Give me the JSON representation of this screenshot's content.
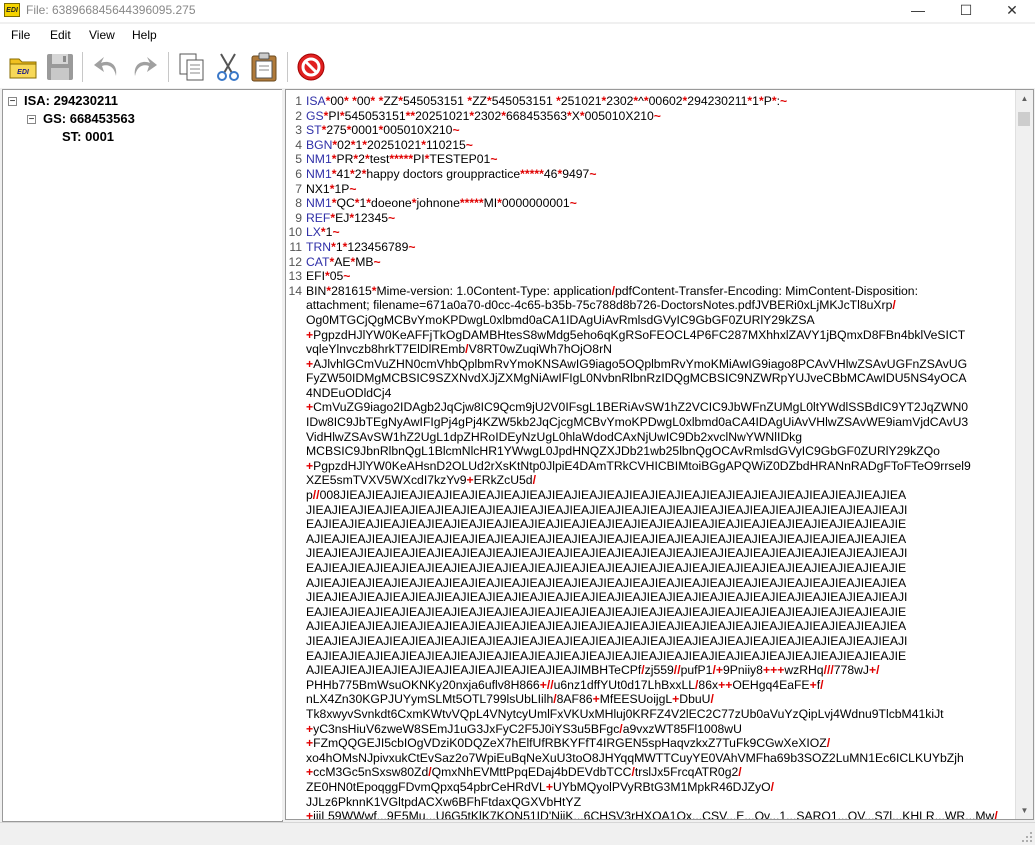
{
  "window": {
    "title": "File: 638966845644396095.275",
    "app_icon_text": "EDI",
    "minimize": "—",
    "maximize": "☐",
    "close": "✕"
  },
  "menu": [
    "File",
    "Edit",
    "View",
    "Help"
  ],
  "toolbar": [
    "open-folder-icon",
    "save-icon",
    "undo-icon",
    "redo-icon",
    "copy-icon",
    "cut-icon",
    "paste-icon",
    "stop-icon"
  ],
  "colors": {
    "segment": "#3030a8",
    "delimiter": "#e00000",
    "stop": "#e02020",
    "folder": "#f0c020"
  },
  "tree": {
    "isa": "ISA: 294230211",
    "gs": "GS: 668453563",
    "st": "ST: 0001",
    "toggle": "−"
  },
  "editor": {
    "line_numbers": [
      "1",
      "2",
      "3",
      "4",
      "5",
      "6",
      "7",
      "8",
      "9",
      "10",
      "11",
      "12",
      "13",
      "14"
    ],
    "lines": [
      "ISA*00*          *00*          *ZZ*545053151      *ZZ*545053151      *251021*2302*^*00602*294230211*1*P*:~",
      "GS*PI*545053151**20251021*2302*668453563*X*005010X210~",
      "ST*275*0001*005010X210~",
      "BGN*02*1*20251021*110215~",
      "NM1*PR*2*test*****PI*TESTEP01~",
      "NM1*41*2*happy doctors grouppractice*****46*9497~",
      "NX1*1P~",
      "NM1*QC*1*doeone*johnone*****MI*0000000001~",
      "REF*EJ*12345~",
      "LX*1~",
      "TRN*1*123456789~",
      "CAT*AE*MB~",
      "EFI*05~",
      "BIN*281615*Mime-version: 1.0Content-Type: application/pdfContent-Transfer-Encoding: MimContent-Disposition:",
      "attachment; filename=671a0a70-d0cc-4c65-b35b-75c788d8b726-DoctorsNotes.pdfJVBERi0xLjMKJcTl8uXrp/",
      "Og0MTGCjQgMCBvYmoKPDwgL0xlbmd0aCA1IDAgUiAvRmlsdGVyIC9GbGF0ZURlY29kZSA",
      "+PgpzdHJlYW0KeAFFjTkOgDAMBHtesS8wMdg5eho6qKgRSoFEOCL4P6FC287MXhhxlZAVY1jBQmxD8FBn4bklVeSICT",
      "vqleYlnvczb8hrkT7ElDlREmb/V8RT0wZuqiWh7hOjO8rN",
      "+AJlvhlGCmVuZHN0cmVhbQplbmRvYmoKNSAwIG9iago5OQplbmRvYmoKMiAwIG9iago8PCAvVHlwZSAvUGFnZSAvUG",
      "FyZW50IDMgMCBSIC9SZXNvdXJjZXMgNiAwIFIgL0NvbnRlbnRzIDQgMCBSIC9NZWRpYUJveCBbMCAwIDU5NS4yOCA",
      "4NDEuODldCj4",
      "+CmVuZG9iago2IDAgb2JqCjw8IC9Qcm9jU2V0IFsgL1BERiAvSW1hZ2VCIC9JbWFnZUMgL0ltYWdlSSBdIC9YT2JqZWN0",
      "IDw8IC9JbTEgNyAwIFIgPj4gPj4KZW5kb2JqCjcgMCBvYmoKPDwgL0xlbmd0aCA4IDAgUiAvVHlwZSAvWE9iamVjdCAvU3",
      "VidHlwZSAvSW1hZ2UgL1dpZHRoIDEyNzUgL0hlaWdodCAxNjUwIC9Db2xvclNwYWNlIDkg",
      "MCBSIC9JbnRlbnQgL1BlcmNlcHR1YWwgL0JpdHNQZXJDb21wb25lbnQgOCAvRmlsdGVyIC9GbGF0ZURlY29kZQo",
      "+PgpzdHJlYW0KeAHsnD2OLUd2rXsKtNtp0JlpiE4DAmTRkCVHICBIMtoiBGgAPQWiZ0DZbdHRANnRADgFToFTeO9rrsel9",
      "XZE5smTVXV5WXcdI7kzYv9+ERkZcU5d/",
      "p//008JIEAJIEAJIEAJIEAJIEAJIEAJIEAJIEAJIEAJIEAJIEAJIEAJIEAJIEAJIEAJIEAJIEAJIEAJIEAJIEAJIEAJIEA",
      "JIEAJIEAJIEAJIEAJIEAJIEAJIEAJIEAJIEAJIEAJIEAJIEAJIEAJIEAJIEAJIEAJIEAJIEAJIEAJIEAJIEAJIEAJIEAJI",
      "EAJIEAJIEAJIEAJIEAJIEAJIEAJIEAJIEAJIEAJIEAJIEAJIEAJIEAJIEAJIEAJIEAJIEAJIEAJIEAJIEAJIEAJIEAJIE",
      "AJIEAJIEAJIEAJIEAJIEAJIEAJIEAJIEAJIEAJIEAJIEAJIEAJIEAJIEAJIEAJIEAJIEAJIEAJIEAJIEAJIEAJIEAJIEA",
      "JIEAJIEAJIEAJIEAJIEAJIEAJIEAJIEAJIEAJIEAJIEAJIEAJIEAJIEAJIEAJIEAJIEAJIEAJIEAJIEAJIEAJIEAJIEAJI",
      "EAJIEAJIEAJIEAJIEAJIEAJIEAJIEAJIEAJIEAJIEAJIEAJIEAJIEAJIEAJIEAJIEAJIEAJIEAJIEAJIEAJIEAJIEAJIE",
      "AJIEAJIEAJIEAJIEAJIEAJIEAJIEAJIEAJIEAJIEAJIEAJIEAJIEAJIEAJIEAJIEAJIEAJIEAJIEAJIEAJIEAJIEAJIEA",
      "JIEAJIEAJIEAJIEAJIEAJIEAJIEAJIEAJIEAJIEAJIEAJIEAJIEAJIEAJIEAJIEAJIEAJIEAJIEAJIEAJIEAJIEAJIEAJI",
      "EAJIEAJIEAJIEAJIEAJIEAJIEAJIEAJIEAJIEAJIEAJIEAJIEAJIEAJIEAJIEAJIEAJIEAJIEAJIEAJIEAJIEAJIEAJIE",
      "AJIEAJIEAJIEAJIEAJIEAJIEAJIEAJIEAJIEAJIEAJIEAJIEAJIEAJIEAJIEAJIEAJIEAJIEAJIEAJIEAJIEAJIEAJIEA",
      "JIEAJIEAJIEAJIEAJIEAJIEAJIEAJIEAJIEAJIEAJIEAJIEAJIEAJIEAJIEAJIEAJIEAJIEAJIEAJIEAJIEAJIEAJIEAJI",
      "EAJIEAJIEAJIEAJIEAJIEAJIEAJIEAJIEAJIEAJIEAJIEAJIEAJIEAJIEAJIEAJIEAJIEAJIEAJIEAJIEAJIEAJIEAJIE",
      "AJIEAJIEAJIEAJIEAJIEAJIEAJIEAJIEAJIEAJIEAJIMBHTeCPf/zj559//pufP1/+9Pniiy8+++wzRHq///778wJ+/",
      "PHHb775BmWsuOKNKy20nxja6uflv8H866+//u6nz1dffYUt0d17LhBxxLL/86x++OEHgq4EaFE+f/",
      "nLX4Zn30KGPJUYymSLMt5OTL799lsUbLIilh/8AF86+MfEESUoijgL+DbuU/",
      "Tk8xwyvSvnkdt6CxmKWtvVQpL4VNytcyUmlFxVKUxMHluj0KRFZ4V2lEC2C77zUb0aVuYzQipLvj4Wdnu9TlcbM41kiJt",
      "+yC3nsHiuV6zweW8SEmJ1uG3JxFyC2F5J0iYS3u5BFgc/a9vxzWT85Fl1008wU",
      "+FZmQQGEJI5cbIOgVDziK0DQZeX7hElfUfRBKYFfT4IRGEN5spHaqvzkxZ7TuFk9CGwXeXIOZ/",
      "xo4hOMsNJpivxukCtEvSaz2o7WpiEuBqNeXuU3toO8JHYqqMWTTCuyYE0VAhVMFha69b3SOZ2LuMN1Ec6ICLKUYbZjh",
      "+ccM3Gc5nSxsw80Zd/QmxNhEVMttPpqEDaj4bDEVdbTCC/trslJx5FrcqATR0g2/",
      "ZE0HN0tEpoqggFDvmQpxq54pbrCeHRdVL+UYbMQyolPVyRBtG3M1MpkR46DJZyO/",
      "JJLz6PknnK1VGltpdACXw6BFhFtdaxQGXVbHtYZ",
      "+jjiL59WWwf...9E5Mu...U6G5tKlK7KON51ID'NiiK...6CHSV3rHXQA1Ox...CSV...E...Ov...1...SARO1...QV...S7l...KHLR...WR...Mw/"
    ],
    "line_starts": [
      0,
      1,
      2,
      3,
      4,
      5,
      6,
      7,
      8,
      9,
      10,
      11,
      12,
      13
    ]
  }
}
